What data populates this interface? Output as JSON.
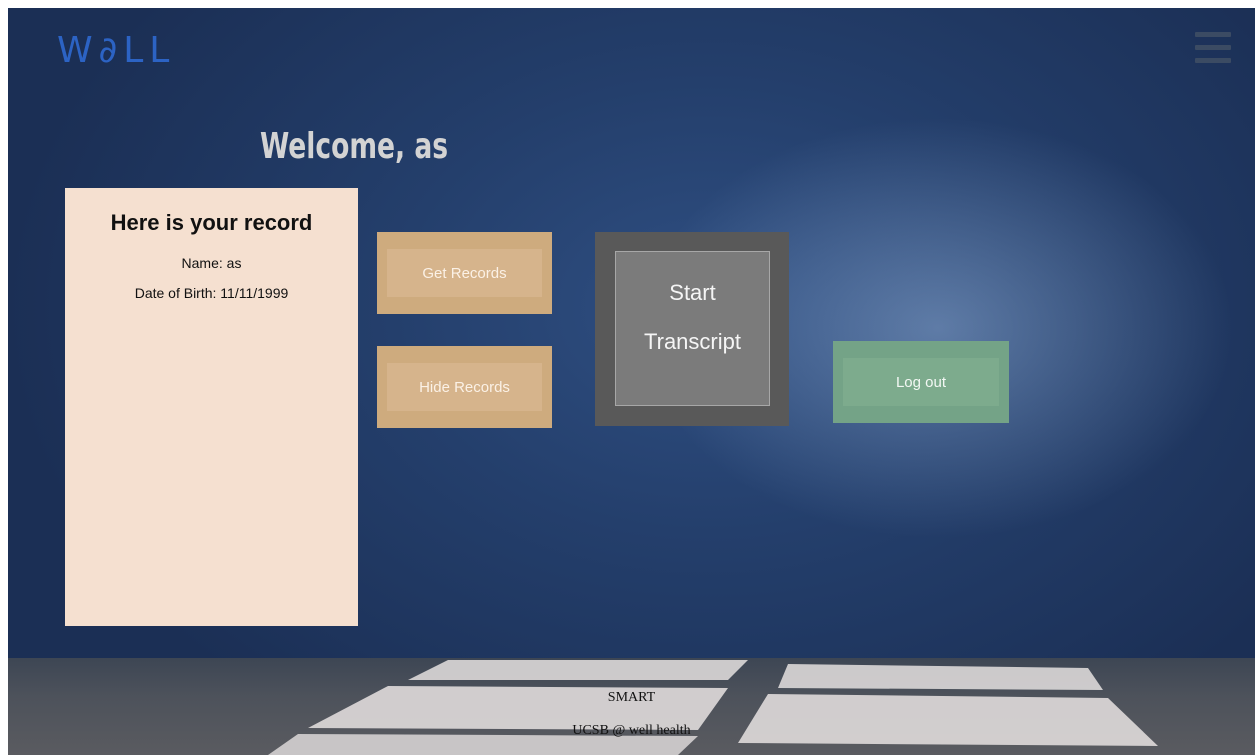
{
  "header": {
    "logo_text": "W∂LL",
    "menu_icon": "hamburger-menu-icon"
  },
  "welcome": {
    "title": "Welcome, as"
  },
  "record_card": {
    "heading": "Here is your record",
    "name_line": "Name: as",
    "dob_line": "Date of Birth: 11/11/1999"
  },
  "buttons": {
    "get_records": "Get Records",
    "hide_records": "Hide Records",
    "start_transcript_line1": "Start",
    "start_transcript_line2": "Transcript",
    "log_out": "Log out"
  },
  "footer": {
    "line1": "SMART",
    "line2": "UCSB @ well health"
  },
  "colors": {
    "logo": "#2c63c4",
    "record_card_bg": "#f5e0d0",
    "records_button": "#ceab7e",
    "transcript_button": "#595959",
    "logout_button": "#74a387"
  }
}
